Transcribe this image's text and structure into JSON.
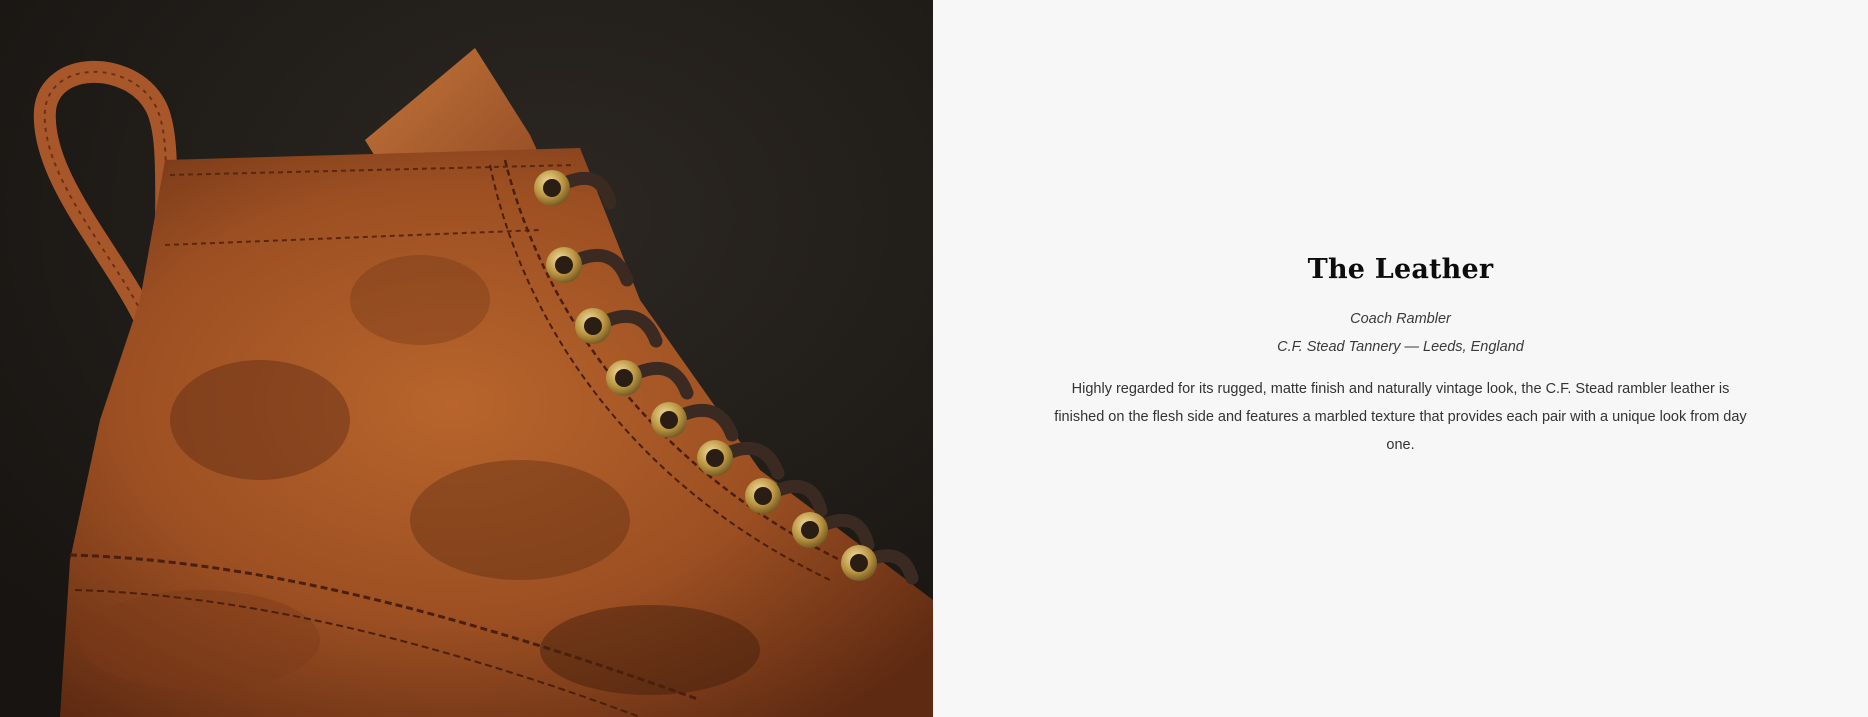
{
  "feature": {
    "title": "The Leather",
    "leather_name": "Coach Rambler",
    "tannery": "C.F. Stead Tannery — Leeds, England",
    "description": "Highly regarded for its rugged, matte finish and naturally vintage look, the C.F. Stead rambler leather is finished on the flesh side and features a marbled texture that provides each pair with a unique look from day one."
  },
  "image": {
    "subject": "boot-leather-closeup",
    "colors": {
      "background": "#24201c",
      "leather": "#a35424",
      "leather_dark": "#6e3315",
      "eyelet": "#c9a95a",
      "lace": "#3a2a22"
    }
  }
}
